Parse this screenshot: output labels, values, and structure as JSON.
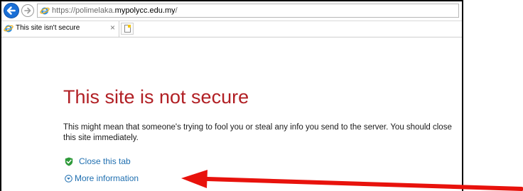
{
  "browser": {
    "url_prefix": "https://polimelaka.",
    "url_host": "mypolycc.edu.my",
    "url_suffix": "/",
    "tab_title": "This site isn't secure",
    "tab_close": "×",
    "back_icon": "back-arrow-icon",
    "forward_icon": "forward-arrow-icon",
    "site_icon": "internet-explorer-icon",
    "new_tab_icon": "new-tab-icon"
  },
  "page": {
    "title": "This site is not secure",
    "description": "This might mean that someone's trying to fool you or steal any info you send to the server. You should close this site immediately.",
    "close_tab_label": "Close this tab",
    "more_info_label": "More information"
  },
  "annotation": {
    "arrow_color": "#e8120c"
  },
  "colors": {
    "title": "#b11f24",
    "link": "#1f6fb0",
    "shield": "#2e9a3a",
    "back_button": "#1a6fd6"
  }
}
